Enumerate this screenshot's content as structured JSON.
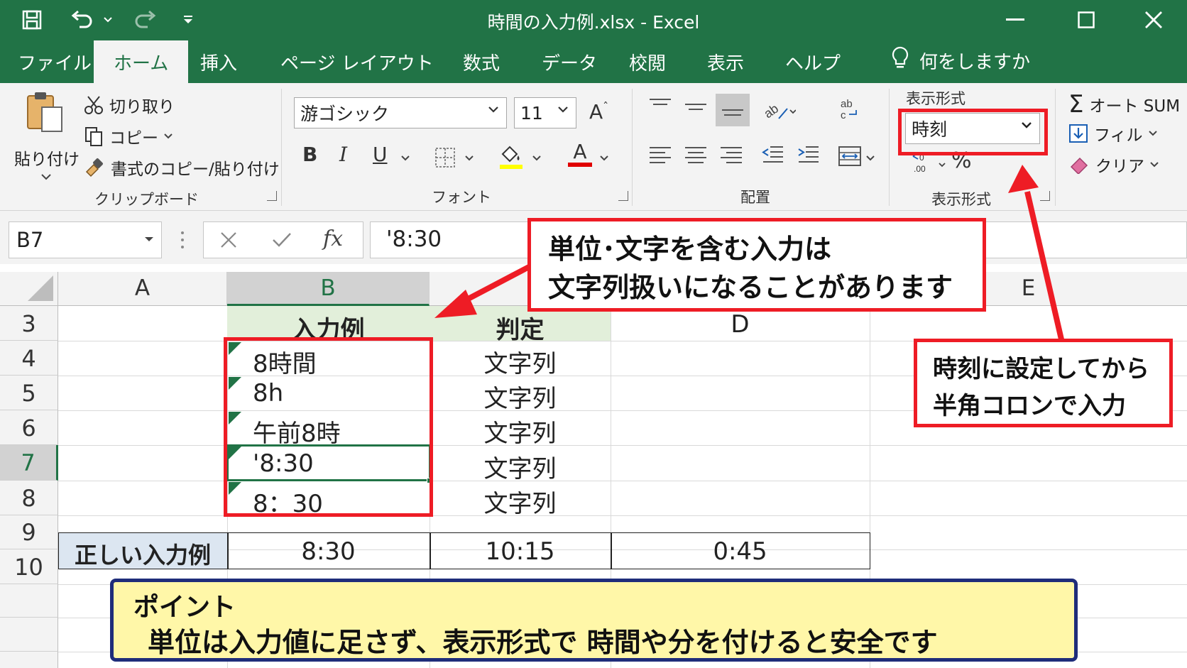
{
  "title_bar": {
    "title": "時間の入力例.xlsx  -  Excel"
  },
  "tabs": [
    {
      "label": "ファイル"
    },
    {
      "label": "ホーム"
    },
    {
      "label": "挿入"
    },
    {
      "label": "ページ レイアウト"
    },
    {
      "label": "数式"
    },
    {
      "label": "データ"
    },
    {
      "label": "校閲"
    },
    {
      "label": "表示"
    },
    {
      "label": "ヘルプ"
    }
  ],
  "tellme": {
    "label": "何をしますか"
  },
  "ribbon": {
    "clipboard": {
      "paste": "貼り付け",
      "cut": "切り取り",
      "copy": "コピー",
      "format_painter": "書式のコピー/貼り付け",
      "group_label": "クリップボード"
    },
    "font": {
      "font_name": "游ゴシック",
      "font_size": "11",
      "grow": "A",
      "bold": "B",
      "italic": "I",
      "underline": "U",
      "font_color": "A",
      "group_label": "フォント"
    },
    "alignment": {
      "group_label": "配置"
    },
    "number": {
      "top_label": "表示形式",
      "format_value": "時刻",
      "percent": "%",
      "group_label": "表示形式"
    },
    "editing": {
      "autosum": "オート SUM",
      "fill": "フィル",
      "clear": "クリア"
    }
  },
  "formula_bar": {
    "name_box": "B7",
    "fx": "fx",
    "formula": "'8:30"
  },
  "grid": {
    "columns": [
      "A",
      "B",
      "D",
      "E"
    ],
    "rows": [
      "3",
      "4",
      "5",
      "6",
      "7",
      "8",
      "9",
      "10"
    ],
    "header_row": {
      "b": "入力例",
      "c": "判定",
      "d": "D"
    },
    "data_rows": [
      {
        "b": "8時間",
        "c": "文字列"
      },
      {
        "b": "8h",
        "c": "文字列"
      },
      {
        "b": "午前8時",
        "c": "文字列"
      },
      {
        "b": "'8:30",
        "c": "文字列"
      },
      {
        "b": "8：30",
        "c": "文字列"
      }
    ],
    "correct_row": {
      "a": "正しい入力例",
      "b": "8:30",
      "c": "10:15",
      "d": "0:45"
    }
  },
  "annotations": {
    "callout_text_line1": "単位･文字を含む入力は",
    "callout_text_line2": "文字列扱いになることがあります",
    "callout_time_line1": "時刻に設定してから",
    "callout_time_line2": "半角コロンで入力",
    "point_title": "ポイント",
    "point_body": "単位は入力値に足さず、表示形式で 時間や分を付けると安全です"
  },
  "colors": {
    "excel_green": "#217346",
    "highlight_red": "#ee1c25",
    "point_bg": "#fff7a8",
    "point_border": "#1f2d7a",
    "header_green": "#e2efda",
    "correct_label_bg": "#dce6f1"
  }
}
